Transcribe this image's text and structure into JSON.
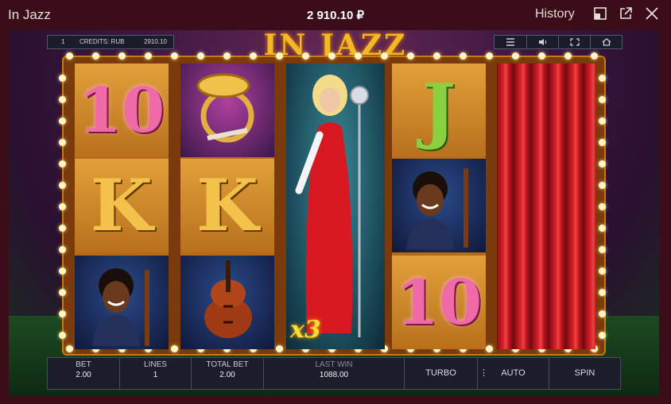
{
  "window": {
    "title": "In Jazz",
    "balance": "2 910.10 ₽",
    "history_label": "History"
  },
  "game": {
    "logo": "IN JAZZ",
    "info": {
      "line_number": "1",
      "credits_label": "CREDITS: RUB",
      "credits_value": "2910.10"
    },
    "toolbar": [
      "menu-icon",
      "sound-icon",
      "fullscreen-icon",
      "home-icon"
    ],
    "reels": [
      [
        "10",
        "horn-icon",
        "K",
        "bassist-icon"
      ],
      [
        "K",
        "cello-icon"
      ],
      [
        "singer-wild"
      ],
      [
        "J",
        "bassist-icon",
        "10"
      ],
      [
        "curtain"
      ]
    ],
    "reel_symbols": {
      "r1": "10",
      "r1b": "K",
      "r2b": "K",
      "r4": "J",
      "r4c": "10"
    },
    "multiplier": "x3"
  },
  "panel": {
    "bet_label": "BET",
    "bet_value": "2.00",
    "lines_label": "LINES",
    "lines_value": "1",
    "total_bet_label": "TOTAL BET",
    "total_bet_value": "2.00",
    "last_win_label": "LAST WIN",
    "last_win_value": "1088.00",
    "turbo_label": "TURBO",
    "auto_label": "AUTO",
    "spin_label": "SPIN"
  }
}
